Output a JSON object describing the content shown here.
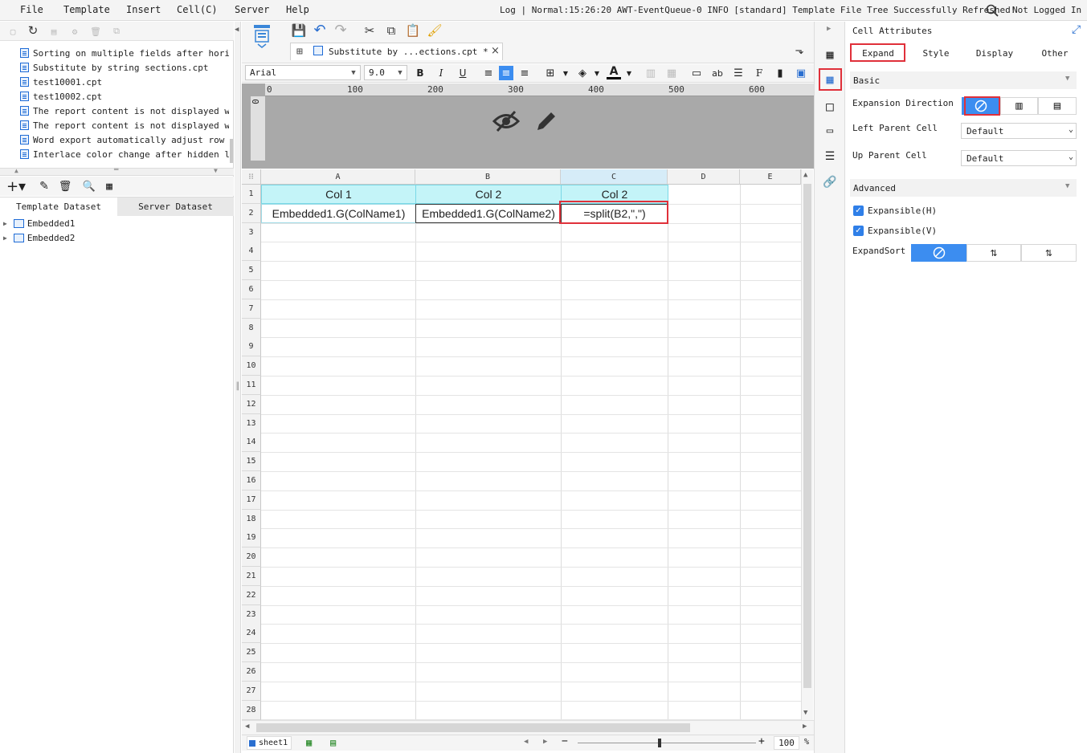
{
  "menu": {
    "file": "File",
    "template": "Template",
    "insert": "Insert",
    "cell": "Cell(C)",
    "server": "Server",
    "help": "Help",
    "log_text": "Log | Normal:15:26:20 AWT-EventQueue-0 INFO [standard] Template File Tree Successfully Refreshed!",
    "user": "Not Logged In"
  },
  "file_tree": {
    "items": [
      "Sorting on multiple fields after horizon",
      "Substitute by string sections.cpt",
      "test10001.cpt",
      "test10002.cpt",
      "The report content is not displayed when",
      "The report content is not displayed when",
      "Word export automatically adjust row hei",
      "Interlace color change after hidden line"
    ]
  },
  "dataset": {
    "tab_template": "Template Dataset",
    "tab_server": "Server Dataset",
    "items": [
      "Embedded1",
      "Embedded2"
    ]
  },
  "editor": {
    "tab_title": "Substitute by ...ections.cpt *",
    "font": "Arial",
    "font_size": "9.0",
    "ruler": [
      "0",
      "100",
      "200",
      "300",
      "400",
      "500",
      "600"
    ],
    "ruler_v": "0"
  },
  "grid": {
    "columns": [
      "A",
      "B",
      "C",
      "D",
      "E"
    ],
    "rows": [
      "1",
      "2",
      "3",
      "4",
      "5",
      "6",
      "7",
      "8",
      "9",
      "10",
      "11",
      "12",
      "13",
      "14",
      "15",
      "16",
      "17",
      "18",
      "19",
      "20",
      "21",
      "22",
      "23",
      "24",
      "25",
      "26",
      "27",
      "28"
    ],
    "cells": {
      "a1": "Col 1",
      "b1": "Col 2",
      "c1": "Col 2",
      "a2": "Embedded1.G(ColName1)",
      "b2": "Embedded1.G(ColName2)",
      "c2": "=split(B2,\",\")"
    }
  },
  "status": {
    "sheet": "sheet1",
    "zoom": "100",
    "zoom_unit": "%"
  },
  "right": {
    "title": "Cell Attributes",
    "tabs": [
      "Expand",
      "Style",
      "Display",
      "Other"
    ],
    "basic": "Basic",
    "expansion_direction": "Expansion Direction",
    "left_parent": "Left Parent Cell",
    "left_parent_value": "Default",
    "up_parent": "Up Parent Cell",
    "up_parent_value": "Default",
    "advanced": "Advanced",
    "expansible_h": "Expansible(H)",
    "expansible_v": "Expansible(V)",
    "expand_sort": "ExpandSort"
  },
  "colors": {
    "accent": "#3c8df0",
    "highlight": "#e0303a",
    "title_cell": "#c4f4f8"
  }
}
